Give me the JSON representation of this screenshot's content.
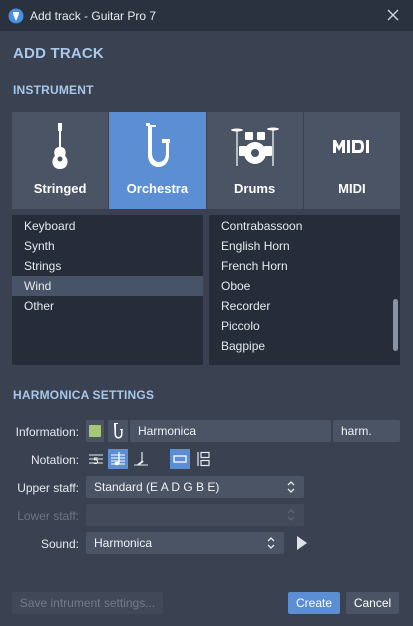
{
  "window": {
    "title": "Add track - Guitar Pro 7"
  },
  "headings": {
    "add_track": "ADD TRACK",
    "instrument": "INSTRUMENT",
    "settings": "HARMONICA SETTINGS"
  },
  "categories": [
    {
      "label": "Stringed",
      "icon": "guitar-icon",
      "selected": false
    },
    {
      "label": "Orchestra",
      "icon": "saxophone-icon",
      "selected": true
    },
    {
      "label": "Drums",
      "icon": "drum-kit-icon",
      "selected": false
    },
    {
      "label": "MIDI",
      "icon": "midi-icon",
      "selected": false
    }
  ],
  "subcategories": [
    {
      "label": "Keyboard",
      "selected": false
    },
    {
      "label": "Synth",
      "selected": false
    },
    {
      "label": "Strings",
      "selected": false
    },
    {
      "label": "Wind",
      "selected": true
    },
    {
      "label": "Other",
      "selected": false
    }
  ],
  "instruments": [
    {
      "label": "Contrabassoon"
    },
    {
      "label": "English Horn"
    },
    {
      "label": "French Horn"
    },
    {
      "label": "Oboe"
    },
    {
      "label": "Recorder"
    },
    {
      "label": "Piccolo"
    },
    {
      "label": "Bagpipe"
    }
  ],
  "settings": {
    "information_label": "Information:",
    "track_name": "Harmonica",
    "short_name": "harm.",
    "notation_label": "Notation:",
    "upper_staff_label": "Upper staff:",
    "upper_staff_value": "Standard (E A D G B E)",
    "lower_staff_label": "Lower staff:",
    "lower_staff_value": "",
    "sound_label": "Sound:",
    "sound_value": "Harmonica",
    "color": "#a4c873"
  },
  "buttons": {
    "save": "Save intrument settings...",
    "create": "Create",
    "cancel": "Cancel"
  },
  "colors": {
    "accent": "#5b8ed3",
    "heading": "#a8c7ea",
    "background": "#3a4251"
  }
}
